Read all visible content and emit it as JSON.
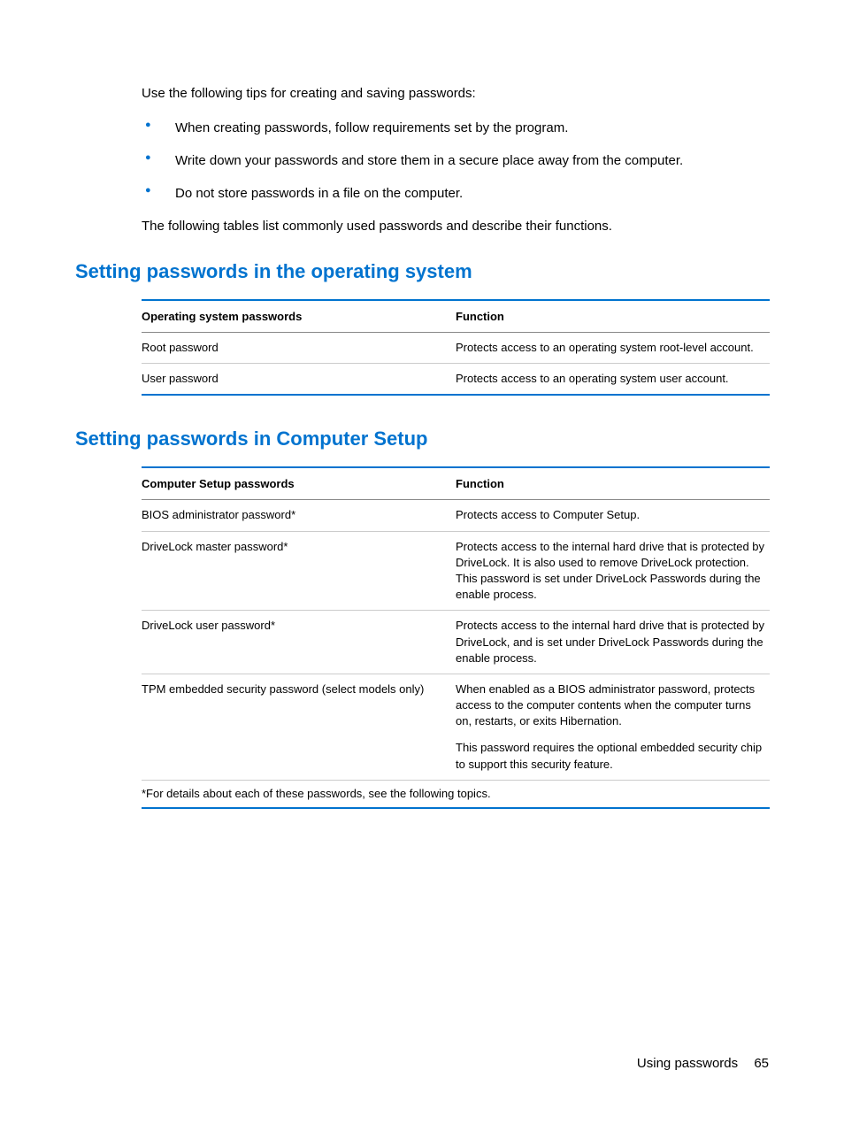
{
  "intro": "Use the following tips for creating and saving passwords:",
  "tips": [
    "When creating passwords, follow requirements set by the program.",
    "Write down your passwords and store them in a secure place away from the computer.",
    "Do not store passwords in a file on the computer."
  ],
  "tablesIntro": "The following tables list commonly used passwords and describe their functions.",
  "section1": {
    "heading": "Setting passwords in the operating system",
    "table": {
      "headers": [
        "Operating system passwords",
        "Function"
      ],
      "rows": [
        {
          "name": "Root password",
          "func": "Protects access to an operating system root-level account."
        },
        {
          "name": "User password",
          "func": "Protects access to an operating system user account."
        }
      ]
    }
  },
  "section2": {
    "heading": "Setting passwords in Computer Setup",
    "table": {
      "headers": [
        "Computer Setup passwords",
        "Function"
      ],
      "rows": [
        {
          "name": "BIOS administrator password*",
          "func": "Protects access to Computer Setup."
        },
        {
          "name": "DriveLock master password*",
          "func": "Protects access to the internal hard drive that is protected by DriveLock. It is also used to remove DriveLock protection. This password is set under DriveLock Passwords during the enable process."
        },
        {
          "name": "DriveLock user password*",
          "func": "Protects access to the internal hard drive that is protected by DriveLock, and is set under DriveLock Passwords during the enable process."
        },
        {
          "name": "TPM embedded security password (select models only)",
          "funcParas": [
            "When enabled as a BIOS administrator password, protects access to the computer contents when the computer turns on, restarts, or exits Hibernation.",
            "This password requires the optional embedded security chip to support this security feature."
          ]
        }
      ],
      "footnote": "*For details about each of these passwords, see the following topics."
    }
  },
  "footer": {
    "label": "Using passwords",
    "page": "65"
  }
}
